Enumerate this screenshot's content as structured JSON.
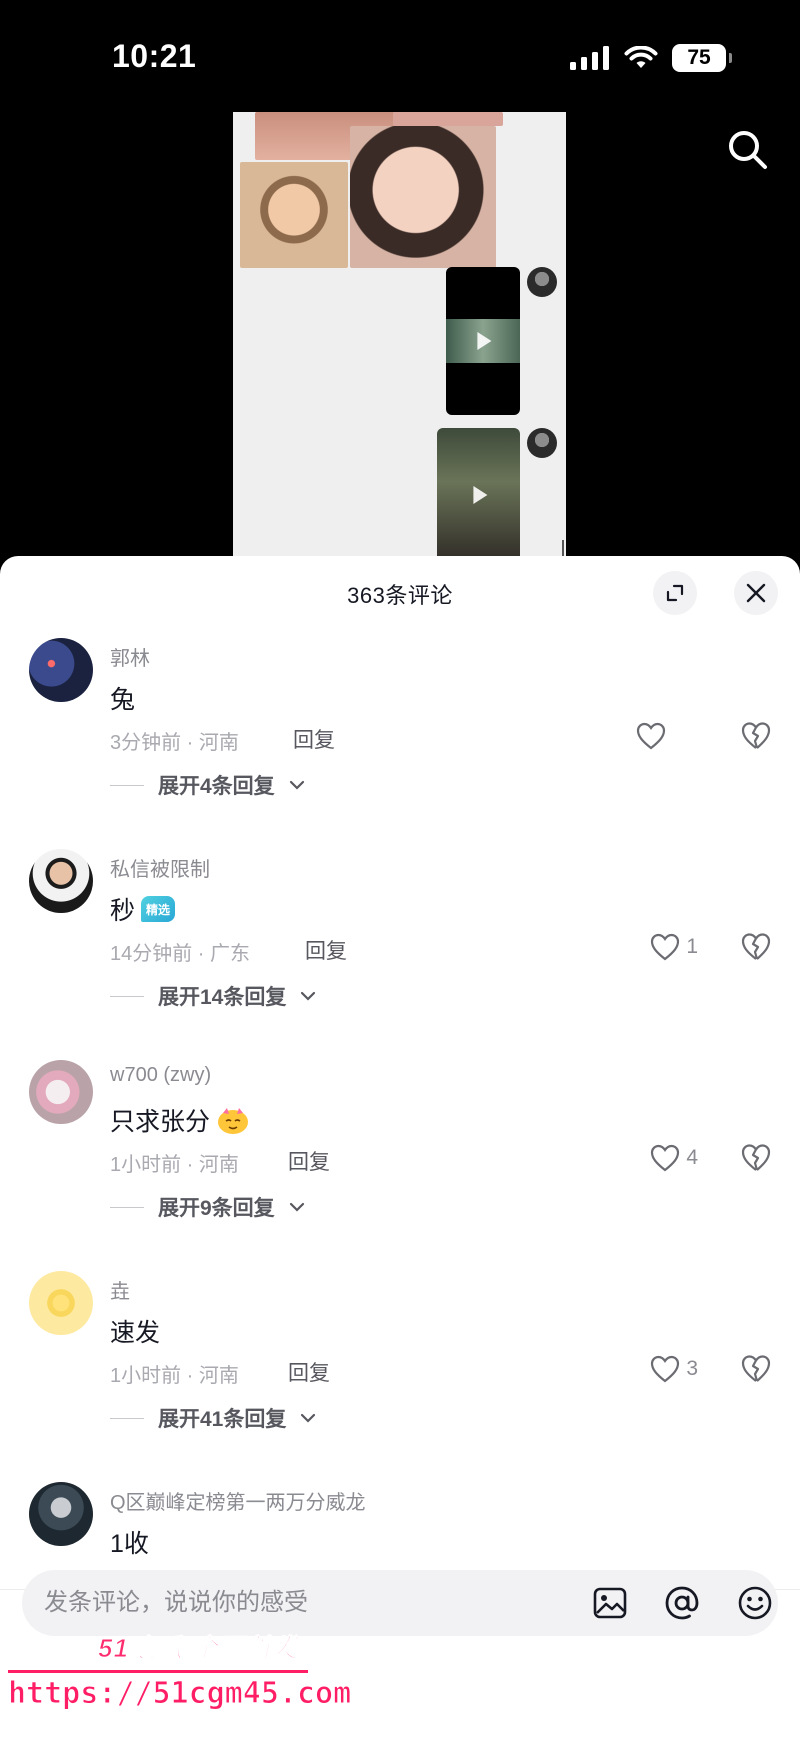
{
  "status_bar": {
    "time": "10:21",
    "battery": "75"
  },
  "sheet": {
    "title": "363条评论"
  },
  "comments": [
    {
      "author": "郭林",
      "text": "兔",
      "meta": "3分钟前 · 河南",
      "reply": "回复",
      "likes": "",
      "expand": "展开4条回复"
    },
    {
      "author": "私信被限制",
      "text": "秒",
      "badge": "精选",
      "meta": "14分钟前 · 广东",
      "reply": "回复",
      "likes": "1",
      "expand": "展开14条回复"
    },
    {
      "author": "w700 (zwy)",
      "text": "只求张分",
      "meta": "1小时前 · 河南",
      "reply": "回复",
      "likes": "4",
      "expand": "展开9条回复"
    },
    {
      "author": "垚",
      "text": "速发",
      "meta": "1小时前 · 河南",
      "reply": "回复",
      "likes": "3",
      "expand": "展开41条回复"
    },
    {
      "author": "Q区巅峰定榜第一两万分威龙",
      "text": "1收"
    }
  ],
  "input": {
    "placeholder": "发条评论，说说你的感受"
  },
  "watermark": {
    "brand": "51吃瓜 全网首发",
    "url": "https://51cgm45.com"
  },
  "colors": {
    "sheet_bg": "#ffffff",
    "text_primary": "#161823",
    "text_secondary": "#8a8b91",
    "badge": "#2aa7d6",
    "watermark": "#ff1e65"
  }
}
